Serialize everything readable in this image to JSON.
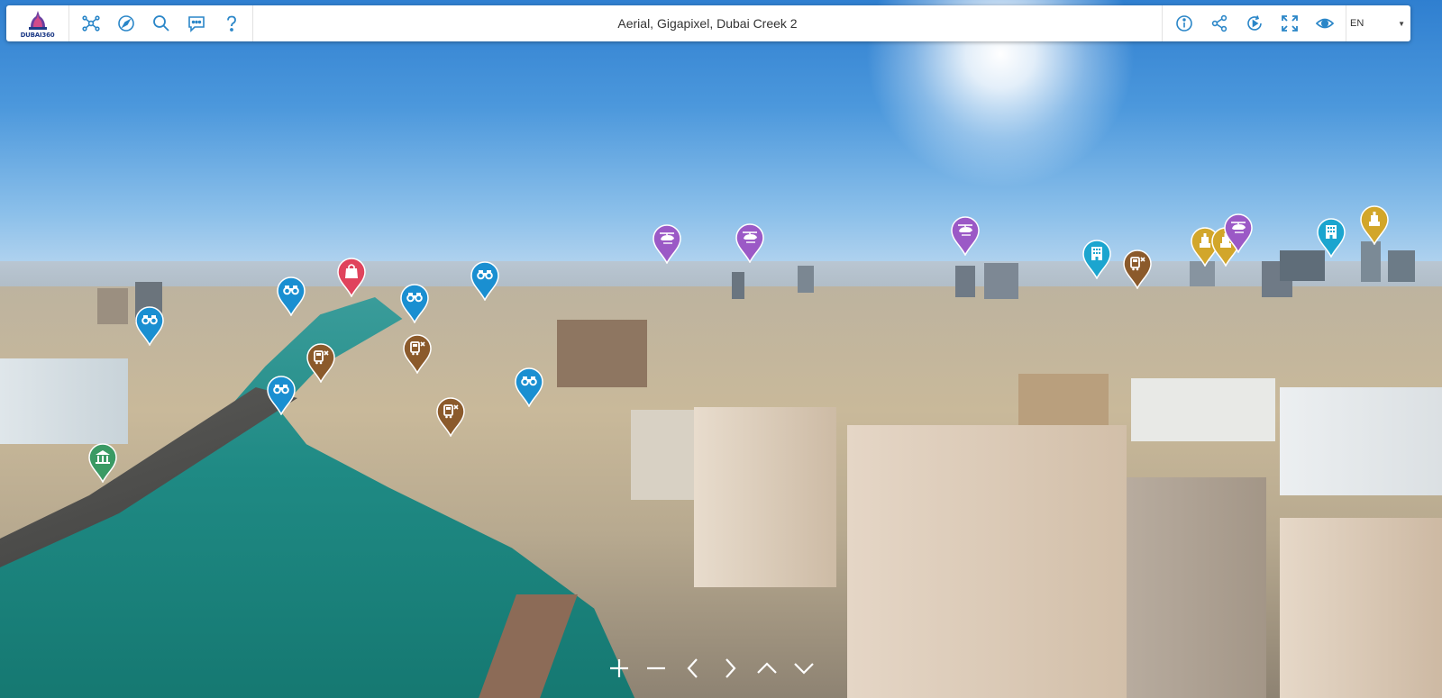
{
  "app": {
    "logo_text": "DUBAI360"
  },
  "header": {
    "title": "Aerial, Gigapixel, Dubai Creek 2"
  },
  "left_toolbar": [
    {
      "name": "network-button",
      "icon": "network-icon",
      "label": ""
    },
    {
      "name": "compass-button",
      "icon": "compass-icon",
      "label": ""
    },
    {
      "name": "search-button",
      "icon": "search-icon",
      "label": ""
    },
    {
      "name": "comments-button",
      "icon": "comment-icon",
      "label": ""
    },
    {
      "name": "help-button",
      "icon": "question-icon",
      "label": ""
    }
  ],
  "right_toolbar": [
    {
      "name": "info-button",
      "icon": "info-icon"
    },
    {
      "name": "share-button",
      "icon": "share-icon"
    },
    {
      "name": "autoplay-button",
      "icon": "rotate-play-icon"
    },
    {
      "name": "fullscreen-button",
      "icon": "fullscreen-icon"
    },
    {
      "name": "view-hotspots-button",
      "icon": "eye-icon"
    }
  ],
  "language": {
    "selected": "EN"
  },
  "pins": [
    {
      "category": "viewpoint",
      "icon": "binoculars-icon",
      "color": "#1a8fd1"
    },
    {
      "category": "viewpoint",
      "icon": "binoculars-icon",
      "color": "#1a8fd1"
    },
    {
      "category": "shopping",
      "icon": "shopping-bag-icon",
      "color": "#e0435c"
    },
    {
      "category": "viewpoint",
      "icon": "binoculars-icon",
      "color": "#1a8fd1"
    },
    {
      "category": "viewpoint",
      "icon": "binoculars-icon",
      "color": "#1a8fd1"
    },
    {
      "category": "transport",
      "icon": "abra-boat-icon",
      "color": "#8b5a2b"
    },
    {
      "category": "transport",
      "icon": "abra-boat-icon",
      "color": "#8b5a2b"
    },
    {
      "category": "viewpoint",
      "icon": "binoculars-icon",
      "color": "#1a8fd1"
    },
    {
      "category": "transport",
      "icon": "abra-boat-icon",
      "color": "#8b5a2b"
    },
    {
      "category": "viewpoint",
      "icon": "binoculars-icon",
      "color": "#1a8fd1"
    },
    {
      "category": "museum",
      "icon": "museum-icon",
      "color": "#3a9a64"
    },
    {
      "category": "helicopter",
      "icon": "helicopter-icon",
      "color": "#9b59c6"
    },
    {
      "category": "helicopter",
      "icon": "helicopter-icon",
      "color": "#9b59c6"
    },
    {
      "category": "helicopter",
      "icon": "helicopter-icon",
      "color": "#9b59c6"
    },
    {
      "category": "hotel",
      "icon": "hotel-icon",
      "color": "#1ba5cf"
    },
    {
      "category": "transport",
      "icon": "abra-boat-icon",
      "color": "#8b5a2b"
    },
    {
      "category": "landmark",
      "icon": "tower-icon",
      "color": "#d2a62a"
    },
    {
      "category": "landmark",
      "icon": "tower-icon",
      "color": "#d2a62a"
    },
    {
      "category": "helicopter",
      "icon": "helicopter-icon",
      "color": "#9b59c6"
    },
    {
      "category": "hotel",
      "icon": "hotel-icon",
      "color": "#1ba5cf"
    },
    {
      "category": "landmark",
      "icon": "tower-icon",
      "color": "#d2a62a"
    }
  ],
  "bottom_nav": [
    {
      "name": "zoom-in-button",
      "icon": "plus-icon"
    },
    {
      "name": "zoom-out-button",
      "icon": "minus-icon"
    },
    {
      "name": "pan-left-button",
      "icon": "chevron-left-icon"
    },
    {
      "name": "pan-right-button",
      "icon": "chevron-right-icon"
    },
    {
      "name": "pan-up-button",
      "icon": "chevron-up-icon"
    },
    {
      "name": "pan-down-button",
      "icon": "chevron-down-icon"
    }
  ],
  "colors": {
    "toolbar_icon": "#2a86c8",
    "toolbar_bg": "#ffffff"
  }
}
